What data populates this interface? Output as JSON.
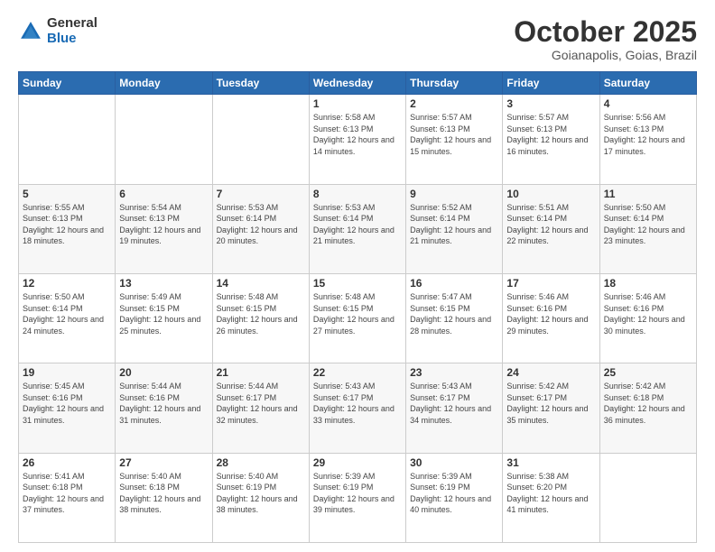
{
  "header": {
    "logo_general": "General",
    "logo_blue": "Blue",
    "month_title": "October 2025",
    "location": "Goianapolis, Goias, Brazil"
  },
  "days_of_week": [
    "Sunday",
    "Monday",
    "Tuesday",
    "Wednesday",
    "Thursday",
    "Friday",
    "Saturday"
  ],
  "weeks": [
    [
      {
        "day": "",
        "info": ""
      },
      {
        "day": "",
        "info": ""
      },
      {
        "day": "",
        "info": ""
      },
      {
        "day": "1",
        "info": "Sunrise: 5:58 AM\nSunset: 6:13 PM\nDaylight: 12 hours and 14 minutes."
      },
      {
        "day": "2",
        "info": "Sunrise: 5:57 AM\nSunset: 6:13 PM\nDaylight: 12 hours and 15 minutes."
      },
      {
        "day": "3",
        "info": "Sunrise: 5:57 AM\nSunset: 6:13 PM\nDaylight: 12 hours and 16 minutes."
      },
      {
        "day": "4",
        "info": "Sunrise: 5:56 AM\nSunset: 6:13 PM\nDaylight: 12 hours and 17 minutes."
      }
    ],
    [
      {
        "day": "5",
        "info": "Sunrise: 5:55 AM\nSunset: 6:13 PM\nDaylight: 12 hours and 18 minutes."
      },
      {
        "day": "6",
        "info": "Sunrise: 5:54 AM\nSunset: 6:13 PM\nDaylight: 12 hours and 19 minutes."
      },
      {
        "day": "7",
        "info": "Sunrise: 5:53 AM\nSunset: 6:14 PM\nDaylight: 12 hours and 20 minutes."
      },
      {
        "day": "8",
        "info": "Sunrise: 5:53 AM\nSunset: 6:14 PM\nDaylight: 12 hours and 21 minutes."
      },
      {
        "day": "9",
        "info": "Sunrise: 5:52 AM\nSunset: 6:14 PM\nDaylight: 12 hours and 21 minutes."
      },
      {
        "day": "10",
        "info": "Sunrise: 5:51 AM\nSunset: 6:14 PM\nDaylight: 12 hours and 22 minutes."
      },
      {
        "day": "11",
        "info": "Sunrise: 5:50 AM\nSunset: 6:14 PM\nDaylight: 12 hours and 23 minutes."
      }
    ],
    [
      {
        "day": "12",
        "info": "Sunrise: 5:50 AM\nSunset: 6:14 PM\nDaylight: 12 hours and 24 minutes."
      },
      {
        "day": "13",
        "info": "Sunrise: 5:49 AM\nSunset: 6:15 PM\nDaylight: 12 hours and 25 minutes."
      },
      {
        "day": "14",
        "info": "Sunrise: 5:48 AM\nSunset: 6:15 PM\nDaylight: 12 hours and 26 minutes."
      },
      {
        "day": "15",
        "info": "Sunrise: 5:48 AM\nSunset: 6:15 PM\nDaylight: 12 hours and 27 minutes."
      },
      {
        "day": "16",
        "info": "Sunrise: 5:47 AM\nSunset: 6:15 PM\nDaylight: 12 hours and 28 minutes."
      },
      {
        "day": "17",
        "info": "Sunrise: 5:46 AM\nSunset: 6:16 PM\nDaylight: 12 hours and 29 minutes."
      },
      {
        "day": "18",
        "info": "Sunrise: 5:46 AM\nSunset: 6:16 PM\nDaylight: 12 hours and 30 minutes."
      }
    ],
    [
      {
        "day": "19",
        "info": "Sunrise: 5:45 AM\nSunset: 6:16 PM\nDaylight: 12 hours and 31 minutes."
      },
      {
        "day": "20",
        "info": "Sunrise: 5:44 AM\nSunset: 6:16 PM\nDaylight: 12 hours and 31 minutes."
      },
      {
        "day": "21",
        "info": "Sunrise: 5:44 AM\nSunset: 6:17 PM\nDaylight: 12 hours and 32 minutes."
      },
      {
        "day": "22",
        "info": "Sunrise: 5:43 AM\nSunset: 6:17 PM\nDaylight: 12 hours and 33 minutes."
      },
      {
        "day": "23",
        "info": "Sunrise: 5:43 AM\nSunset: 6:17 PM\nDaylight: 12 hours and 34 minutes."
      },
      {
        "day": "24",
        "info": "Sunrise: 5:42 AM\nSunset: 6:17 PM\nDaylight: 12 hours and 35 minutes."
      },
      {
        "day": "25",
        "info": "Sunrise: 5:42 AM\nSunset: 6:18 PM\nDaylight: 12 hours and 36 minutes."
      }
    ],
    [
      {
        "day": "26",
        "info": "Sunrise: 5:41 AM\nSunset: 6:18 PM\nDaylight: 12 hours and 37 minutes."
      },
      {
        "day": "27",
        "info": "Sunrise: 5:40 AM\nSunset: 6:18 PM\nDaylight: 12 hours and 38 minutes."
      },
      {
        "day": "28",
        "info": "Sunrise: 5:40 AM\nSunset: 6:19 PM\nDaylight: 12 hours and 38 minutes."
      },
      {
        "day": "29",
        "info": "Sunrise: 5:39 AM\nSunset: 6:19 PM\nDaylight: 12 hours and 39 minutes."
      },
      {
        "day": "30",
        "info": "Sunrise: 5:39 AM\nSunset: 6:19 PM\nDaylight: 12 hours and 40 minutes."
      },
      {
        "day": "31",
        "info": "Sunrise: 5:38 AM\nSunset: 6:20 PM\nDaylight: 12 hours and 41 minutes."
      },
      {
        "day": "",
        "info": ""
      }
    ]
  ]
}
